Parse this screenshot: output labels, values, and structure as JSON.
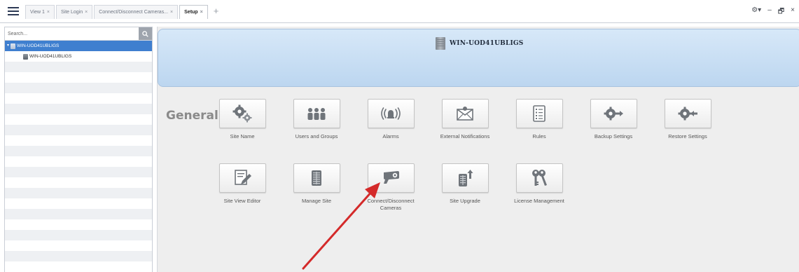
{
  "tabs": [
    {
      "label": "View 1",
      "close": "×",
      "active": false
    },
    {
      "label": "Site Login",
      "close": "×",
      "active": false
    },
    {
      "label": "Connect/Disconnect Cameras...",
      "close": "×",
      "active": false
    },
    {
      "label": "Setup",
      "close": "×",
      "active": true
    }
  ],
  "tab_add": "+",
  "window_controls": {
    "settings": "⚙▾",
    "minimize": "–",
    "restore": "🗗",
    "close": "×"
  },
  "sidebar": {
    "search_placeholder": "Search...",
    "tree": {
      "root": "WIN-UOD41UBLIGS",
      "child": "WIN-UOD41UBLIGS"
    }
  },
  "banner": {
    "title": "WIN-UOD41UBLIGS"
  },
  "section": {
    "label": "General"
  },
  "tiles_row1": [
    {
      "label": "Site Name",
      "icon": "gears-icon"
    },
    {
      "label": "Users and Groups",
      "icon": "users-icon"
    },
    {
      "label": "Alarms",
      "icon": "alarm-icon"
    },
    {
      "label": "External Notifications",
      "icon": "envelope-icon"
    },
    {
      "label": "Rules",
      "icon": "rules-icon"
    },
    {
      "label": "Backup Settings",
      "icon": "gear-arrow-out-icon"
    },
    {
      "label": "Restore Settings",
      "icon": "gear-arrow-in-icon"
    }
  ],
  "tiles_row2": [
    {
      "label": "Site View Editor",
      "icon": "pencil-icon"
    },
    {
      "label": "Manage Site",
      "icon": "building-icon"
    },
    {
      "label": "Connect/Disconnect",
      "label2": "Cameras",
      "icon": "camera-icon"
    },
    {
      "label": "Site Upgrade",
      "icon": "upgrade-icon"
    },
    {
      "label": "License Management",
      "icon": "keys-icon"
    }
  ],
  "colors": {
    "accent": "#3f7fcf",
    "arrow": "#d42a2a",
    "banner": "#c6dcf2"
  }
}
